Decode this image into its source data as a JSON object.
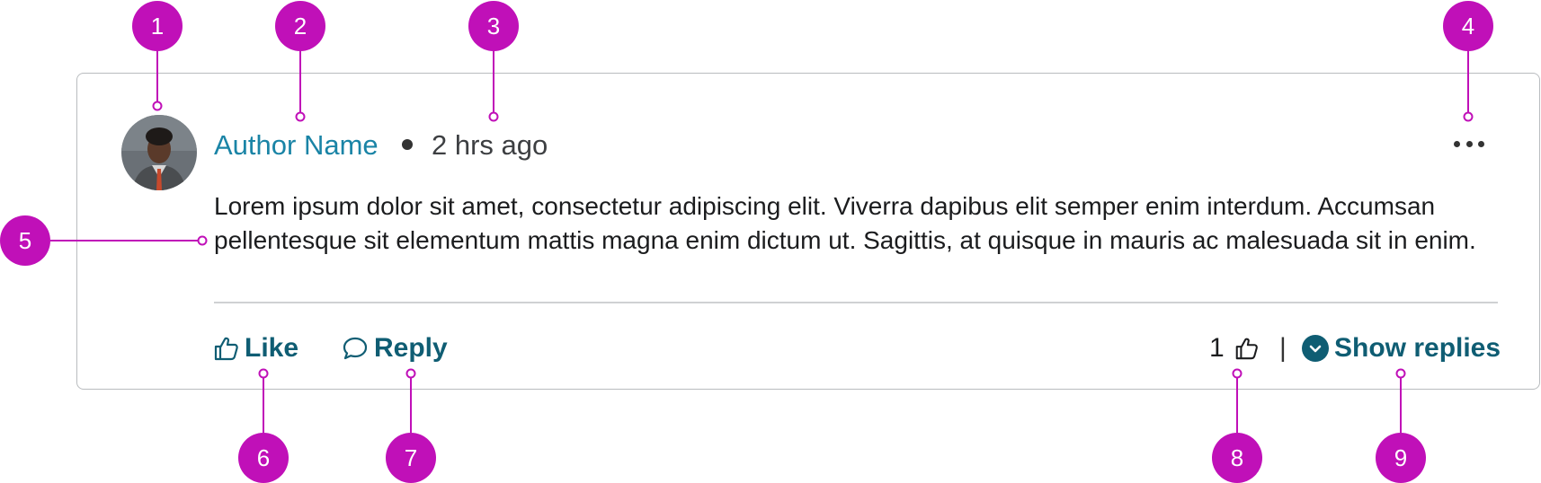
{
  "comment": {
    "author_name": "Author Name",
    "timestamp": "2 hrs ago",
    "body": "Lorem ipsum dolor sit amet, consectetur adipiscing elit. Viverra dapibus elit semper enim interdum. Accumsan pellentesque sit elementum mattis magna enim dictum ut. Sagittis, at quisque in mauris ac malesuada sit in enim.",
    "like_label": "Like",
    "reply_label": "Reply",
    "like_count": "1",
    "separator": "|",
    "show_replies_label": "Show replies"
  },
  "callouts": [
    "1",
    "2",
    "3",
    "4",
    "5",
    "6",
    "7",
    "8",
    "9"
  ],
  "colors": {
    "author": "#1a84a6",
    "action": "#0f5d73",
    "callout": "#c010b8",
    "border": "#b9bcbf"
  },
  "icons": {
    "like": "thumbs-up-icon",
    "reply": "speech-bubble-icon",
    "count": "thumbs-up-icon",
    "show_replies": "chevron-down-circle-icon",
    "more": "more-horizontal-icon"
  }
}
